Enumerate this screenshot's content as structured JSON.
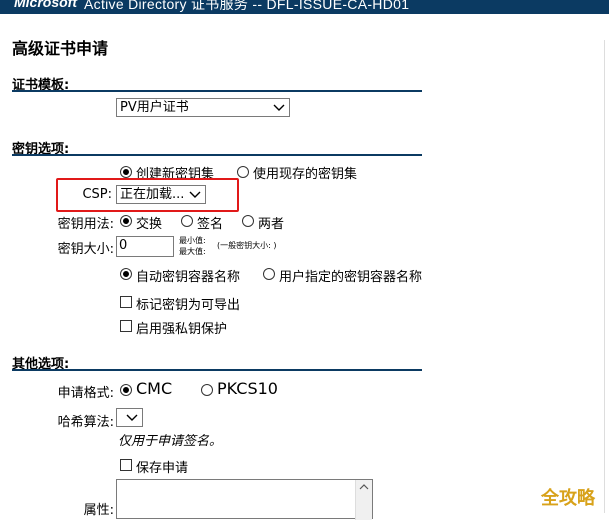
{
  "banner": {
    "brand": "Microsoft",
    "title": "Active Directory 证书服务  --  DFL-ISSUE-CA-HD01"
  },
  "page_title": "高级证书申请",
  "cert_template": {
    "header": "证书模板:",
    "selected": "PV用户证书"
  },
  "key_options": {
    "header": "密钥选项:",
    "keyset_new": "创建新密钥集",
    "keyset_existing": "使用现存的密钥集",
    "csp_label": "CSP:",
    "csp_value": "正在加载...",
    "usage_label": "密钥用法:",
    "usage_exchange": "交换",
    "usage_signature": "签名",
    "usage_both": "两者",
    "size_label": "密钥大小:",
    "size_value": "0",
    "size_min": "最小值:",
    "size_max": "最大值:",
    "size_hint": "(一般密钥大小: )",
    "container_auto": "自动密钥容器名称",
    "container_user": "用户指定的密钥容器名称",
    "exportable": "标记密钥为可导出",
    "strong_protection": "启用强私钥保护"
  },
  "other_options": {
    "header": "其他选项:",
    "format_label": "申请格式:",
    "format_cmc": "CMC",
    "format_pkcs10": "PKCS10",
    "hash_label": "哈希算法:",
    "hash_note": "仅用于申请签名。",
    "save_request": "保存申请",
    "attributes_label": "属性:"
  },
  "watermark": "全攻略",
  "colors": {
    "banner": "#0b3a62",
    "highlight": "#e11919",
    "watermark": "#d8a21a"
  }
}
